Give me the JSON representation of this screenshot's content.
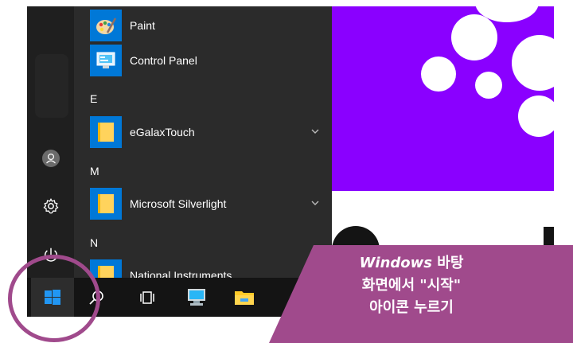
{
  "start_menu": {
    "apps": [
      {
        "label": "Paint",
        "icon": "paint-icon"
      },
      {
        "label": "Control Panel",
        "icon": "control-panel-icon"
      },
      {
        "label": "eGalaxTouch",
        "icon": "folder-icon",
        "expandable": true
      },
      {
        "label": "Microsoft Silverlight",
        "icon": "folder-icon",
        "expandable": true
      },
      {
        "label": "National Instruments",
        "icon": "folder-icon"
      }
    ],
    "letters": [
      "E",
      "M",
      "N"
    ],
    "rail_icons": [
      "user-icon",
      "settings-icon",
      "power-icon"
    ]
  },
  "taskbar": {
    "items": [
      "windows-start-icon",
      "search-icon",
      "task-view-icon",
      "computer-icon",
      "file-explorer-icon"
    ]
  },
  "annotation": {
    "line1_word": "Windows",
    "line1_rest": " 바탕",
    "line2": "화면에서 \"시작\"",
    "line3": "아이콘 누르기"
  },
  "colors": {
    "accent": "#0078d7",
    "wallpaper": "#8a00ff",
    "callout": "#a04a8c",
    "folder": "#ffd35c"
  }
}
